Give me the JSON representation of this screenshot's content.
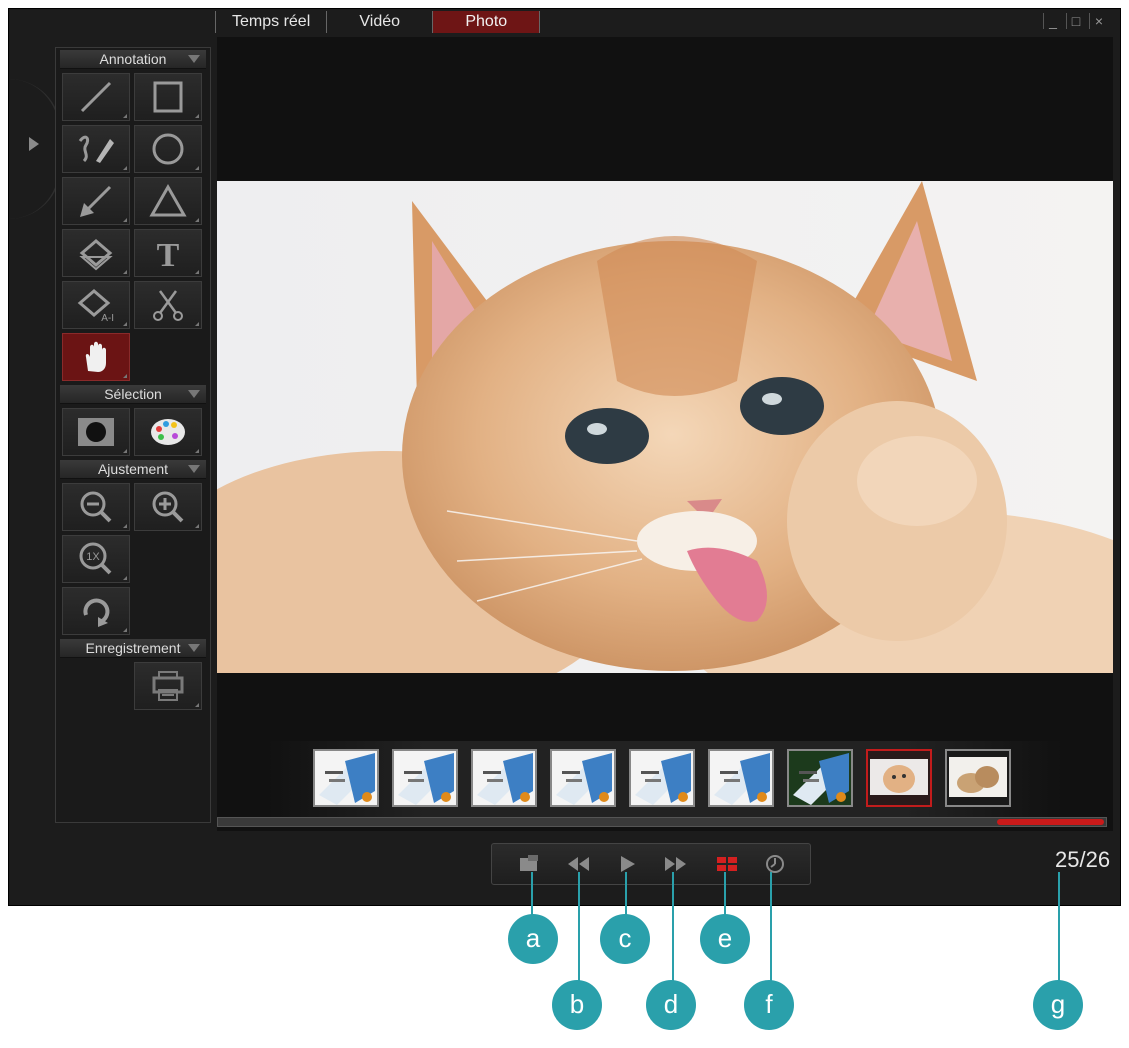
{
  "tabs": [
    {
      "label": "Temps réel"
    },
    {
      "label": "Vidéo"
    },
    {
      "label": "Photo",
      "active": true
    }
  ],
  "window_controls": {
    "minimize": "_",
    "maximize": "□",
    "close": "×"
  },
  "toolbar": {
    "annotation_label": "Annotation",
    "selection_label": "Sélection",
    "adjust_label": "Ajustement",
    "record_label": "Enregistrement",
    "eraser_sub_label": "A-I",
    "tools": [
      "line-icon",
      "rectangle-icon",
      "freehand-pen-icon",
      "circle-icon",
      "arrow-icon",
      "triangle-icon",
      "eraser-icon",
      "text-icon",
      "eraser-all-icon",
      "scissors-icon",
      "hand-icon"
    ],
    "selection_tools": [
      "spotlight-icon",
      "color-palette-icon"
    ],
    "adjust_tools": [
      "zoom-out-icon",
      "zoom-in-icon",
      "zoom-1x-icon",
      "rotate-icon"
    ],
    "zoom_1x_label": "1X",
    "record_tools": [
      "print-icon"
    ]
  },
  "filmstrip": {
    "thumbnails": [
      {
        "kind": "document"
      },
      {
        "kind": "document"
      },
      {
        "kind": "document"
      },
      {
        "kind": "document"
      },
      {
        "kind": "document"
      },
      {
        "kind": "document"
      },
      {
        "kind": "document-green"
      },
      {
        "kind": "kitten",
        "selected": true
      },
      {
        "kind": "kittens"
      }
    ]
  },
  "progress": {
    "fraction": 0.12,
    "color": "#c91a1a"
  },
  "controls": [
    "snapshot-icon",
    "rewind-icon",
    "play-icon",
    "fast-forward-icon",
    "thumbnail-grid-icon",
    "timer-icon"
  ],
  "counter": {
    "text": "25/26"
  },
  "callouts": [
    "a",
    "b",
    "c",
    "d",
    "e",
    "f",
    "g"
  ],
  "colors": {
    "accent_red": "#6e1515",
    "callout_teal": "#2aa0ab"
  }
}
